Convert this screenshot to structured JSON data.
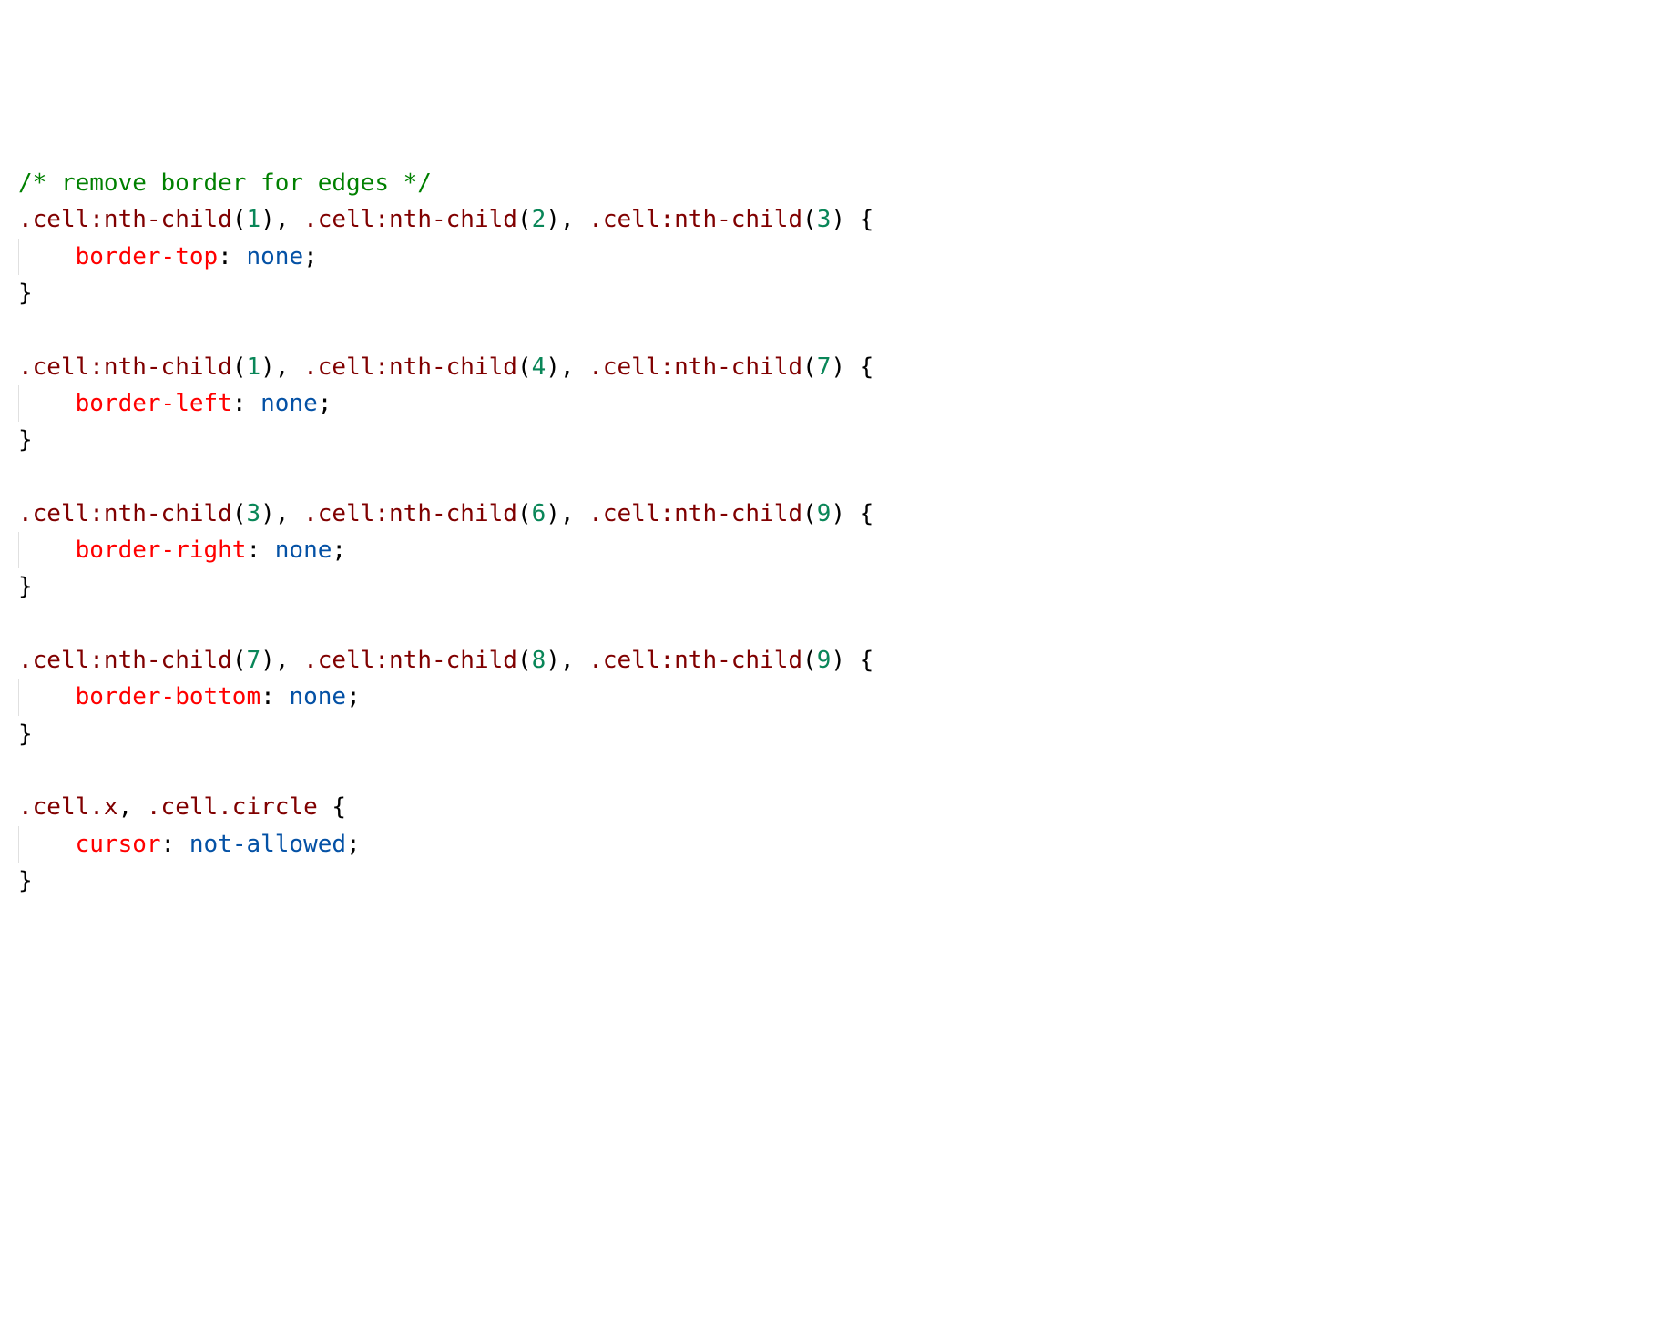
{
  "code": {
    "comment": "/* remove border for edges */",
    "block1": {
      "selector_line": ".cell:nth-child(1), .cell:nth-child(2), .cell:nth-child(3) {",
      "prop": "border-top",
      "value": "none",
      "close": "}"
    },
    "block2": {
      "selector_line": ".cell:nth-child(1), .cell:nth-child(4), .cell:nth-child(7) {",
      "prop": "border-left",
      "value": "none",
      "close": "}"
    },
    "block3": {
      "selector_line": ".cell:nth-child(3), .cell:nth-child(6), .cell:nth-child(9) {",
      "prop": "border-right",
      "value": "none",
      "close": "}"
    },
    "block4": {
      "selector_line": ".cell:nth-child(7), .cell:nth-child(8), .cell:nth-child(9) {",
      "prop": "border-bottom",
      "value": "none",
      "close": "}"
    },
    "block5": {
      "selector_line": ".cell.x, .cell.circle {",
      "prop": "cursor",
      "value": "not-allowed",
      "close": "}"
    },
    "nums": {
      "b1": [
        "1",
        "2",
        "3"
      ],
      "b2": [
        "1",
        "4",
        "7"
      ],
      "b3": [
        "3",
        "6",
        "9"
      ],
      "b4": [
        "7",
        "8",
        "9"
      ]
    }
  }
}
